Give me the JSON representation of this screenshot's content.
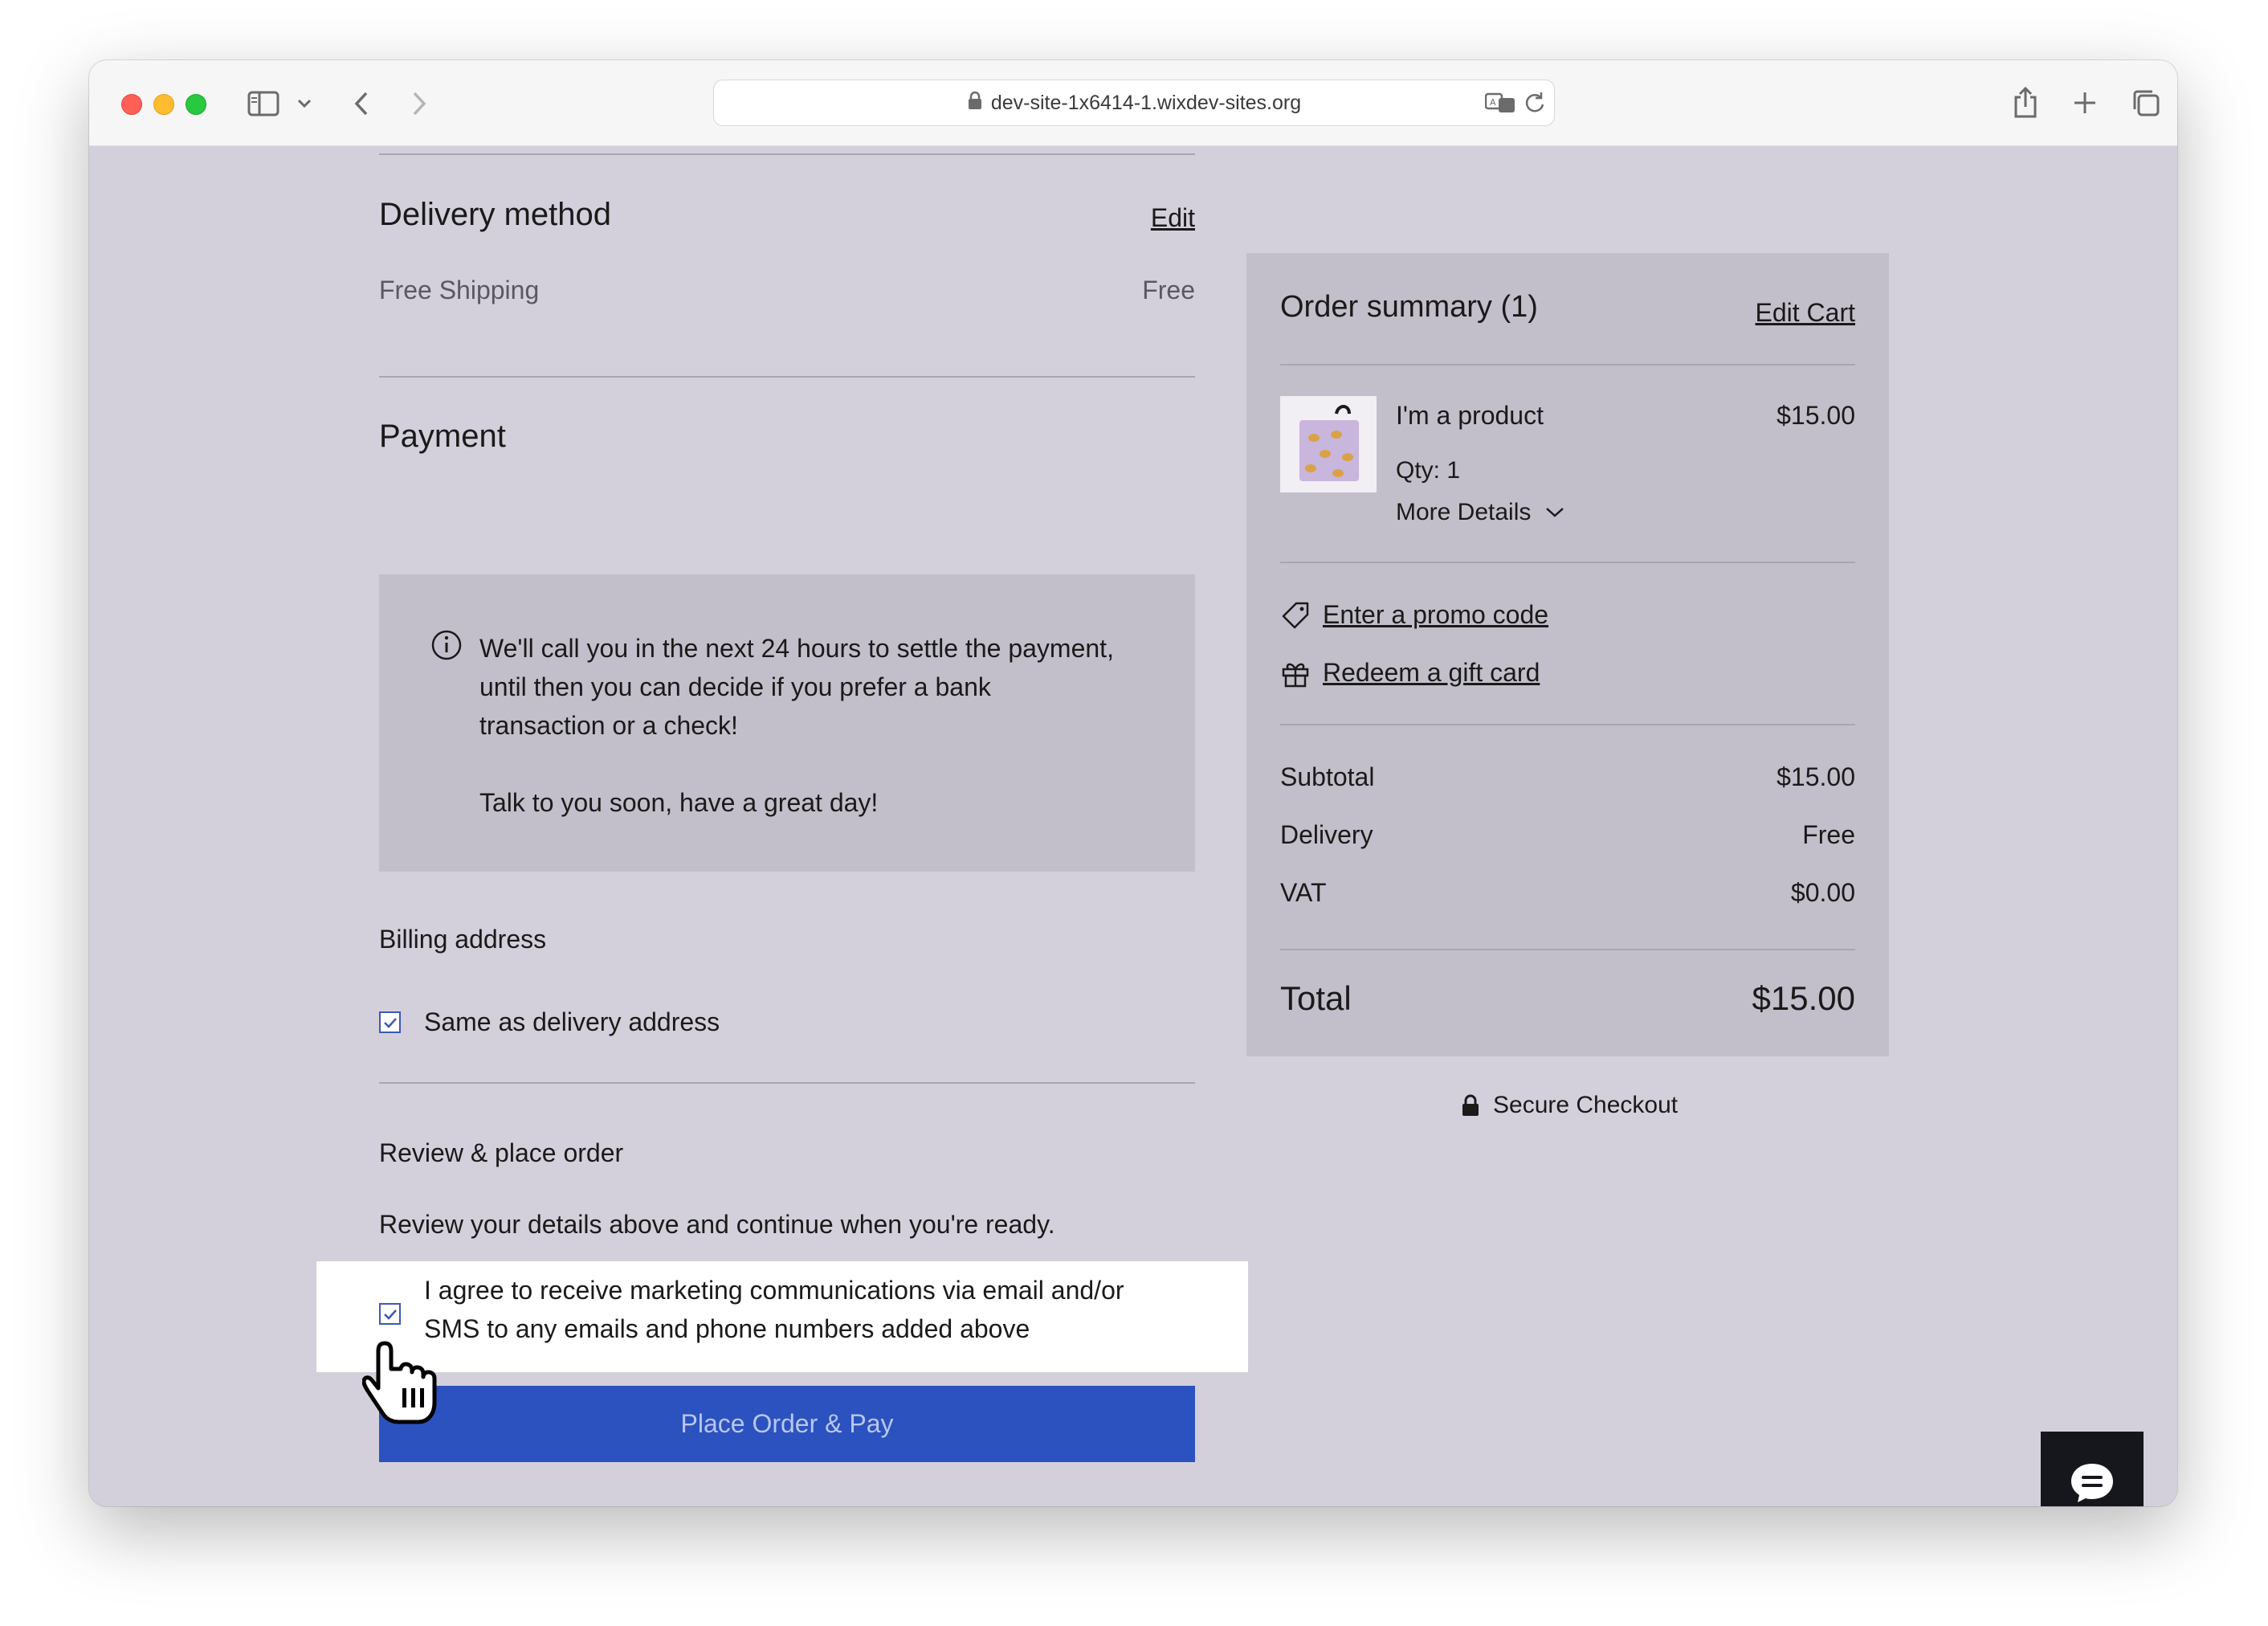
{
  "browser": {
    "url": "dev-site-1x6414-1.wixdev-sites.org"
  },
  "delivery": {
    "title": "Delivery method",
    "edit_label": "Edit",
    "method": "Free Shipping",
    "price": "Free"
  },
  "payment": {
    "title": "Payment",
    "info_line1": "We'll call you in the next 24 hours to settle the payment,",
    "info_line2": "until then you can decide if you prefer a bank",
    "info_line3": "transaction or a check!",
    "info_line4": "Talk to you soon, have a great day!"
  },
  "billing": {
    "title": "Billing address",
    "same_as_delivery_label": "Same as delivery address",
    "same_as_delivery_checked": true
  },
  "review": {
    "title": "Review & place order",
    "description": "Review your details above and continue when you're ready.",
    "marketing_line1": "I agree to receive marketing communications via email and/or",
    "marketing_line2": "SMS to any emails and phone numbers added above",
    "marketing_checked": true,
    "place_order_label": "Place Order & Pay"
  },
  "summary": {
    "title": "Order summary (1)",
    "edit_cart_label": "Edit Cart",
    "product": {
      "name": "I'm a product",
      "price": "$15.00",
      "qty": "Qty: 1",
      "more_details": "More Details"
    },
    "promo_label": "Enter a promo code",
    "gift_label": "Redeem a gift card",
    "subtotal_label": "Subtotal",
    "subtotal_value": "$15.00",
    "delivery_label": "Delivery",
    "delivery_value": "Free",
    "vat_label": "VAT",
    "vat_value": "$0.00",
    "total_label": "Total",
    "total_value": "$15.00",
    "secure_label": "Secure Checkout"
  },
  "colors": {
    "accent": "#2b52be",
    "page_bg": "#d3d0db",
    "panel_bg": "#c2bfca"
  }
}
